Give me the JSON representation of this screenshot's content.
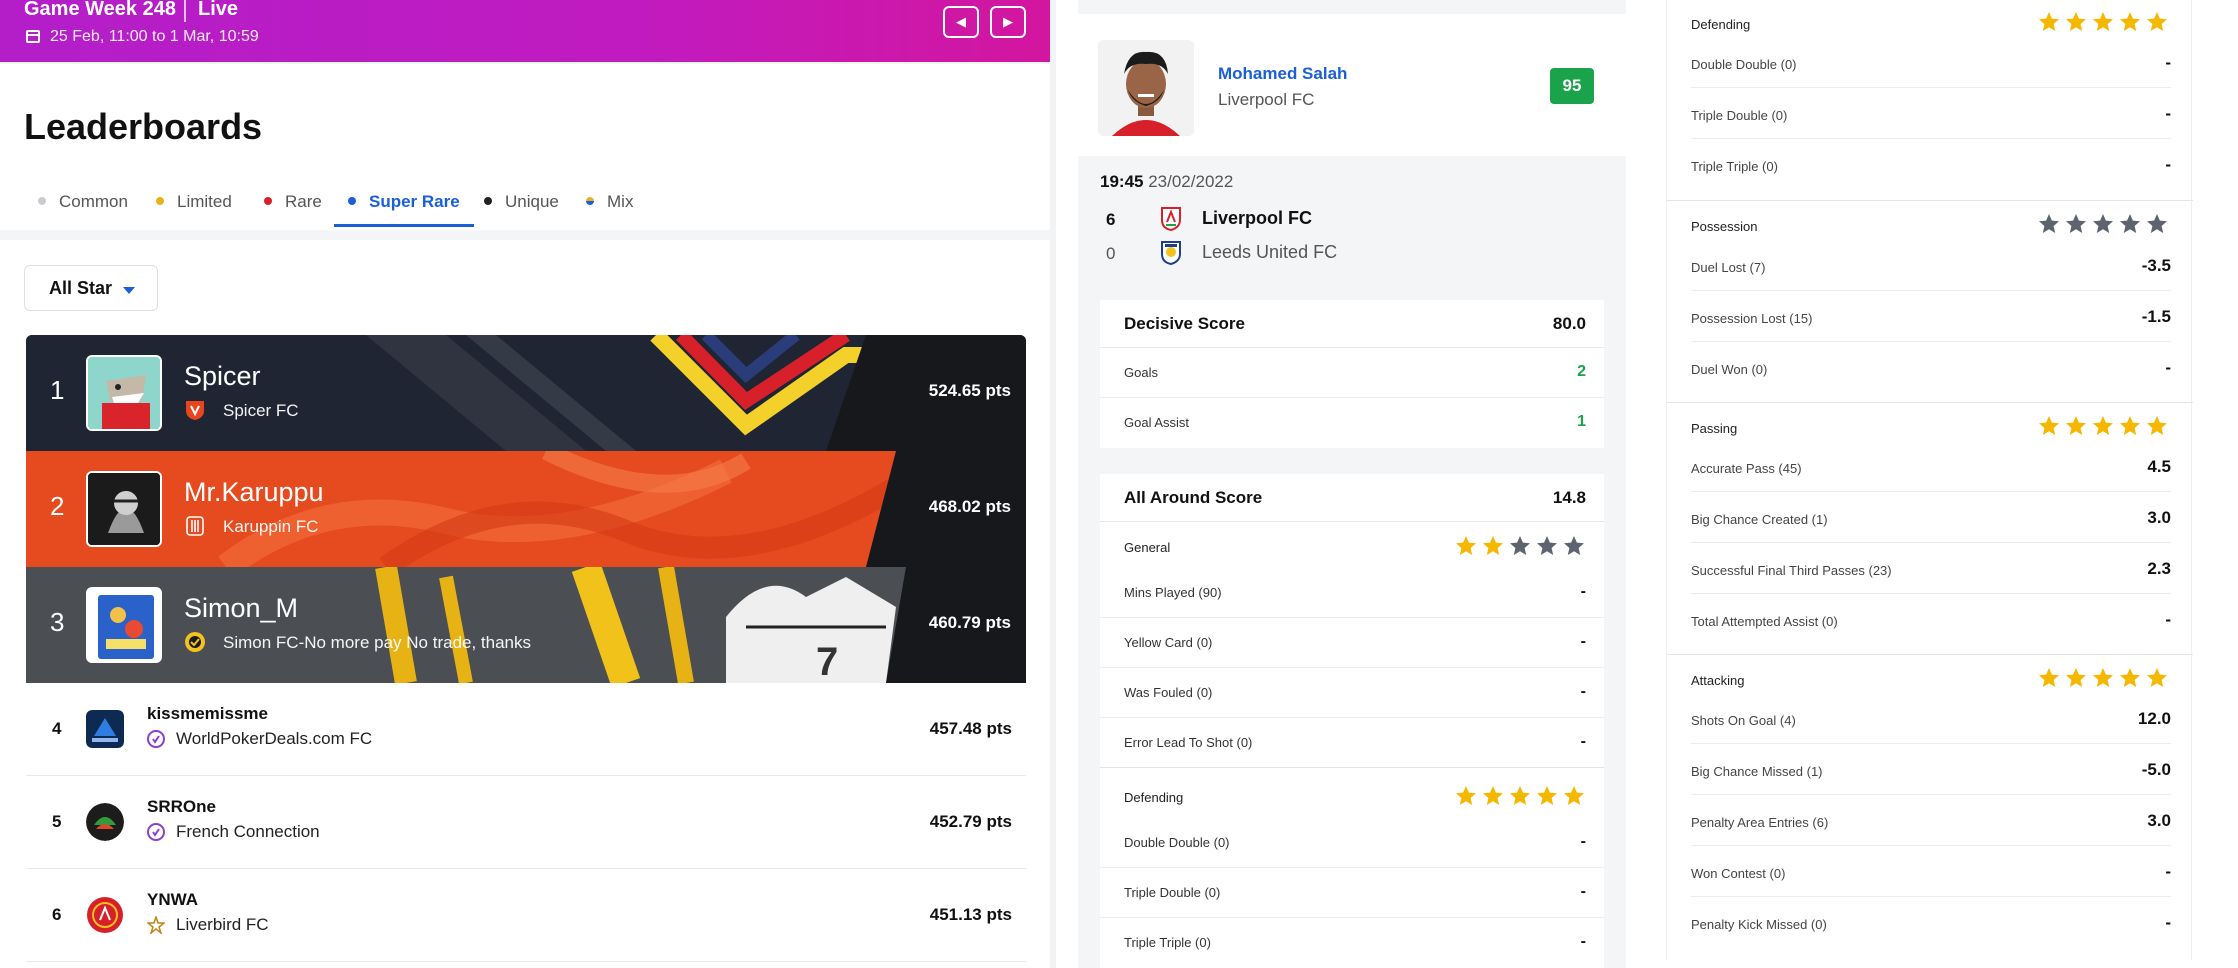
{
  "gameweek": {
    "title": "Game Week 248",
    "status": "Live",
    "dates": "25 Feb, 11:00 to 1 Mar, 10:59",
    "prev_icon": "chevron-left-icon",
    "next_icon": "chevron-right-icon"
  },
  "leaderboards": {
    "title": "Leaderboards",
    "tabs": [
      {
        "label": "Common",
        "color": "#c9ccd1"
      },
      {
        "label": "Limited",
        "color": "#e9b21c"
      },
      {
        "label": "Rare",
        "color": "#d8202b"
      },
      {
        "label": "Super Rare",
        "color": "#1a5fd6"
      },
      {
        "label": "Unique",
        "color": "#222222"
      },
      {
        "label": "Mix",
        "color": "#1a5fd6"
      }
    ],
    "active_tab": "Super Rare",
    "filter": "All Star",
    "top_rows": [
      {
        "rank": "1",
        "name": "Spicer",
        "club": "Spicer FC",
        "points": "524.65 pts"
      },
      {
        "rank": "2",
        "name": "Mr.Karuppu",
        "club": "Karuppin FC",
        "points": "468.02 pts"
      },
      {
        "rank": "3",
        "name": "Simon_M",
        "club": "Simon FC-No more pay No trade, thanks",
        "points": "460.79 pts"
      }
    ],
    "rows": [
      {
        "rank": "4",
        "name": "kissmemissme",
        "club": "WorldPokerDeals.com FC",
        "points": "457.48 pts"
      },
      {
        "rank": "5",
        "name": "SRROne",
        "club": "French Connection",
        "points": "452.79 pts"
      },
      {
        "rank": "6",
        "name": "YNWA",
        "club": "Liverbird FC",
        "points": "451.13 pts"
      }
    ]
  },
  "player": {
    "name": "Mohamed Salah",
    "club": "Liverpool FC",
    "score": "95"
  },
  "match": {
    "time": "19:45",
    "date": "23/02/2022",
    "home": {
      "score": "6",
      "team": "Liverpool FC"
    },
    "away": {
      "score": "0",
      "team": "Leeds United FC"
    }
  },
  "decisive": {
    "label": "Decisive Score",
    "value": "80.0",
    "rows": [
      {
        "label": "Goals",
        "value": "2"
      },
      {
        "label": "Goal Assist",
        "value": "1"
      }
    ]
  },
  "all_around": {
    "label": "All Around Score",
    "value": "14.8",
    "general": {
      "label": "General",
      "stars": 2,
      "rows": [
        {
          "label": "Mins Played (90)",
          "value": "-"
        },
        {
          "label": "Yellow Card (0)",
          "value": "-"
        },
        {
          "label": "Was Fouled (0)",
          "value": "-"
        },
        {
          "label": "Error Lead To Shot (0)",
          "value": "-"
        }
      ]
    },
    "defending": {
      "label": "Defending",
      "stars": 5,
      "rows": [
        {
          "label": "Double Double (0)",
          "value": "-"
        },
        {
          "label": "Triple Double (0)",
          "value": "-"
        },
        {
          "label": "Triple Triple (0)",
          "value": "-"
        }
      ]
    }
  },
  "right_sections": [
    {
      "label": "Defending",
      "stars": 5,
      "rows": [
        {
          "label": "Double Double (0)",
          "value": "-"
        },
        {
          "label": "Triple Double (0)",
          "value": "-"
        },
        {
          "label": "Triple Triple (0)",
          "value": "-"
        }
      ]
    },
    {
      "label": "Possession",
      "stars": 0,
      "rows": [
        {
          "label": "Duel Lost (7)",
          "value": "-3.5"
        },
        {
          "label": "Possession Lost (15)",
          "value": "-1.5"
        },
        {
          "label": "Duel Won (0)",
          "value": "-"
        }
      ]
    },
    {
      "label": "Passing",
      "stars": 5,
      "rows": [
        {
          "label": "Accurate Pass (45)",
          "value": "4.5"
        },
        {
          "label": "Big Chance Created (1)",
          "value": "3.0"
        },
        {
          "label": "Successful Final Third Passes (23)",
          "value": "2.3"
        },
        {
          "label": "Total Attempted Assist (0)",
          "value": "-"
        }
      ]
    },
    {
      "label": "Attacking",
      "stars": 5,
      "rows": [
        {
          "label": "Shots On Goal (4)",
          "value": "12.0"
        },
        {
          "label": "Big Chance Missed (1)",
          "value": "-5.0"
        },
        {
          "label": "Penalty Area Entries (6)",
          "value": "3.0"
        },
        {
          "label": "Won Contest (0)",
          "value": "-"
        },
        {
          "label": "Penalty Kick Missed (0)",
          "value": "-"
        }
      ]
    }
  ],
  "colors": {
    "accent": "#1a5fd6",
    "score_green": "#1aa34a",
    "star_gold": "#f5b700",
    "star_grey": "#5d6470",
    "header_magenta": "#c01bc0"
  }
}
